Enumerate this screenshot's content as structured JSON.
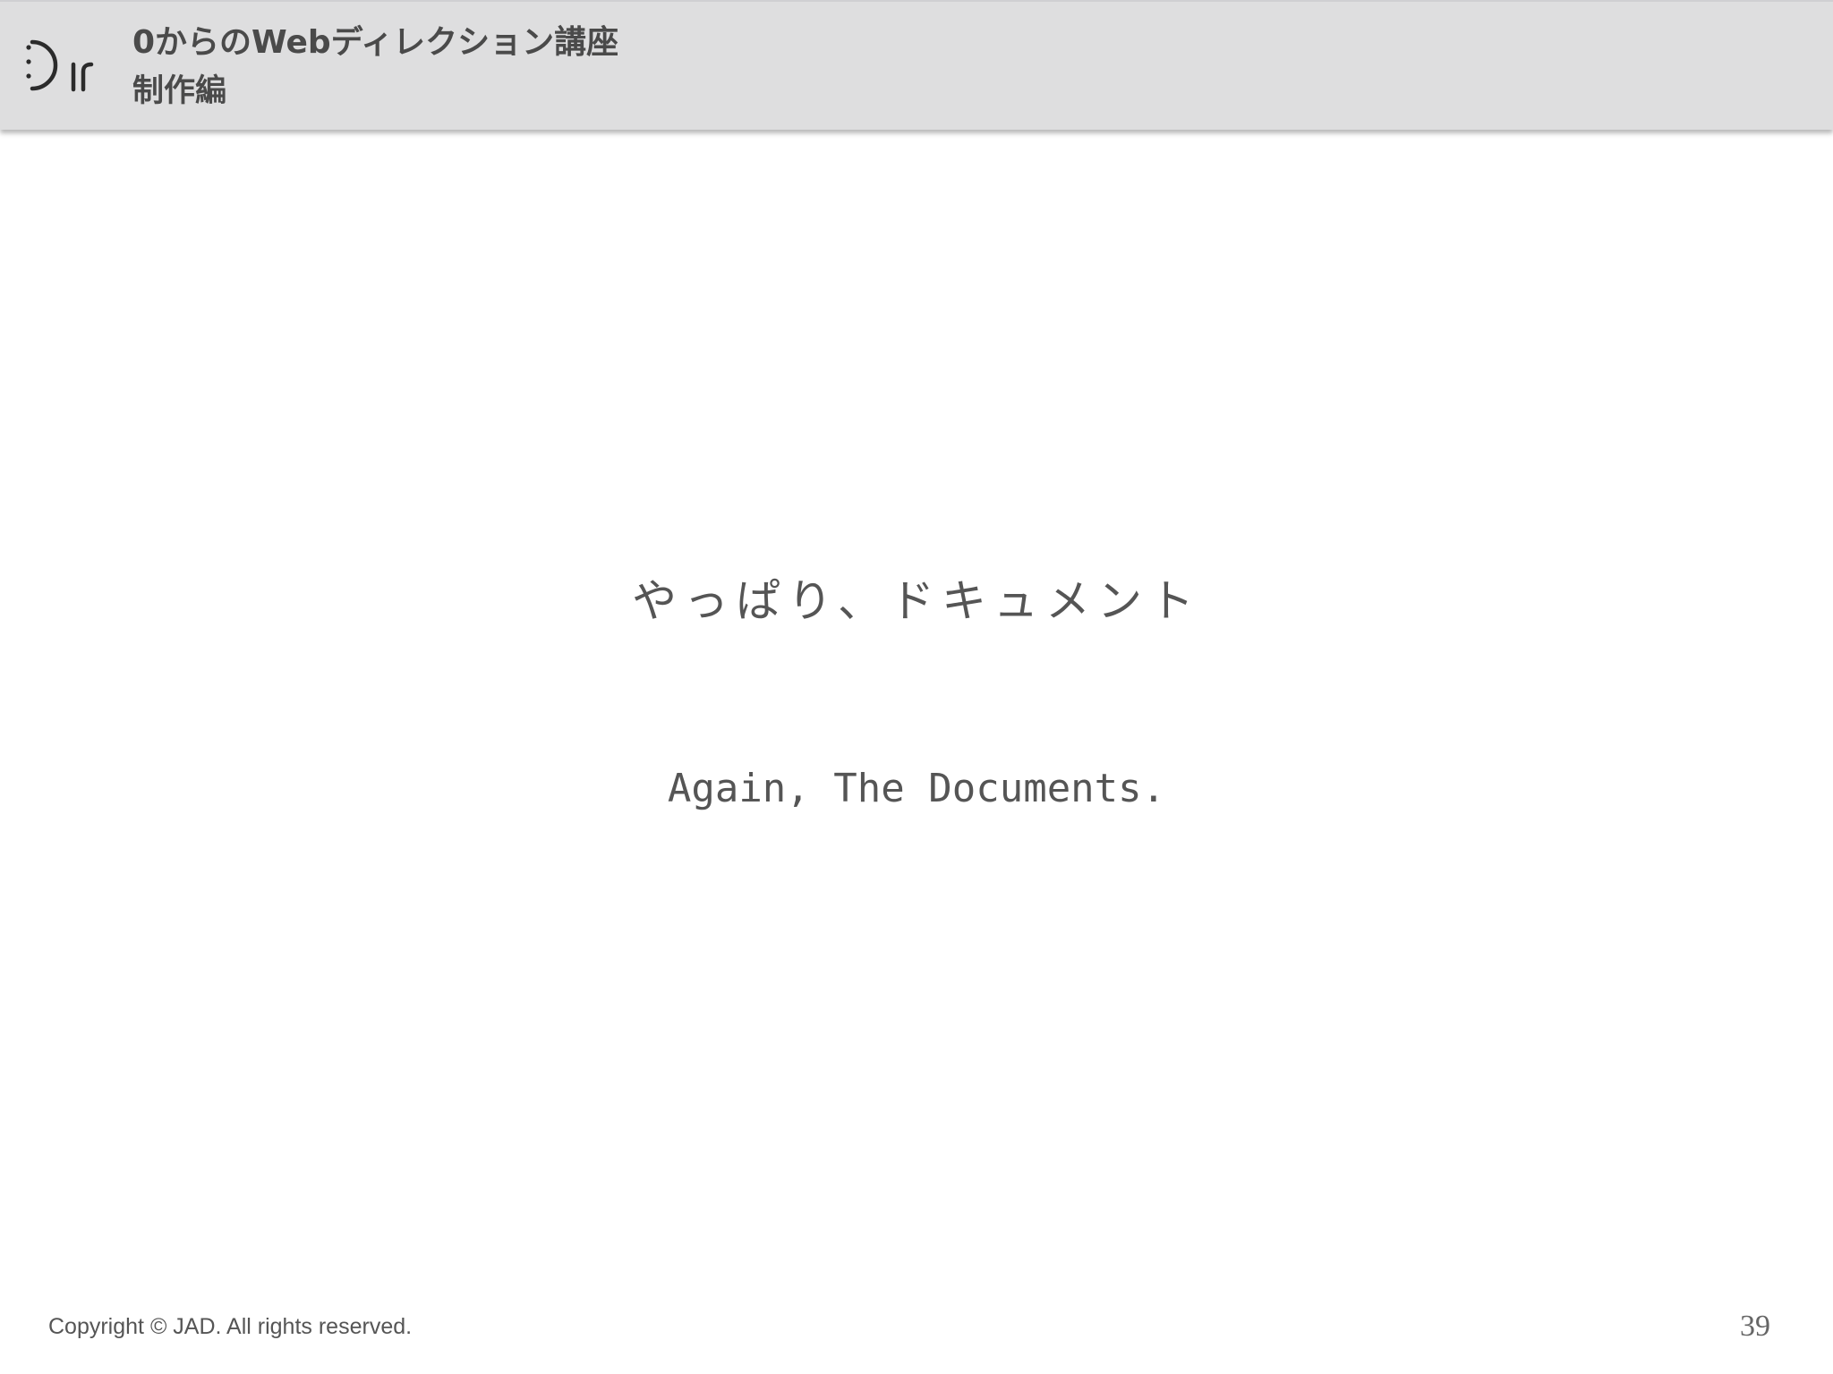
{
  "header": {
    "logo_icon": "dir-logo-icon",
    "course_title": "0からのWebディレクション講座",
    "course_subtitle": "制作編"
  },
  "main": {
    "heading_ja": "やっぱり、ドキュメント",
    "heading_en": "Again, The Documents."
  },
  "footer": {
    "copyright": "Copyright © JAD. All rights reserved.",
    "page_number": "39"
  },
  "colors": {
    "header_bg": "#dededf",
    "text": "#555555"
  }
}
